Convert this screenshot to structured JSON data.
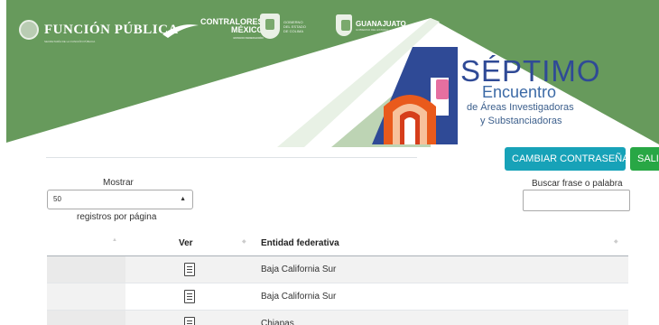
{
  "header": {
    "logos": {
      "funcion_publica": "FUNCIÓN PÚBLICA",
      "funcion_publica_sub": "SECRETARÍA DE LA FUNCIÓN PÚBLICA",
      "contralores_line1": "CONTRALORES",
      "contralores_line2": "MÉXICO",
      "contralores_sub": "ESTADO FEDERACIÓN",
      "colima_line1": "GOBIERNO",
      "colima_line2": "DEL ESTADO",
      "colima_line3": "DE COLIMA",
      "guanajuato": "GUANAJUATO",
      "guanajuato_sub": "GOBIERNO DEL ESTADO"
    },
    "event": {
      "title": "SÉPTIMO",
      "subtitle": "Encuentro",
      "line1": "de Áreas Investigadoras",
      "line2": "y Substanciadoras"
    },
    "colors": {
      "banner_green": "#679a5c",
      "title_blue": "#2f4a96",
      "accent_orange": "#e95a1c",
      "accent_pink": "#e56fa0"
    }
  },
  "toolbar": {
    "change_password_label": "CAMBIAR CONTRASEÑA",
    "exit_label": "SALIR",
    "change_password_color": "#17a2b8",
    "exit_color": "#28a745"
  },
  "table_controls": {
    "show_label": "Mostrar",
    "page_length_value": "50",
    "per_page_label": "registros por página",
    "search_label": "Buscar frase o palabra",
    "search_value": ""
  },
  "table": {
    "columns": [
      "",
      "Ver",
      "Entidad federativa"
    ],
    "rows": [
      {
        "icon": "document-icon",
        "entity": "Baja California Sur"
      },
      {
        "icon": "document-icon",
        "entity": "Baja California Sur"
      },
      {
        "icon": "document-icon",
        "entity": "Chiapas"
      }
    ]
  }
}
